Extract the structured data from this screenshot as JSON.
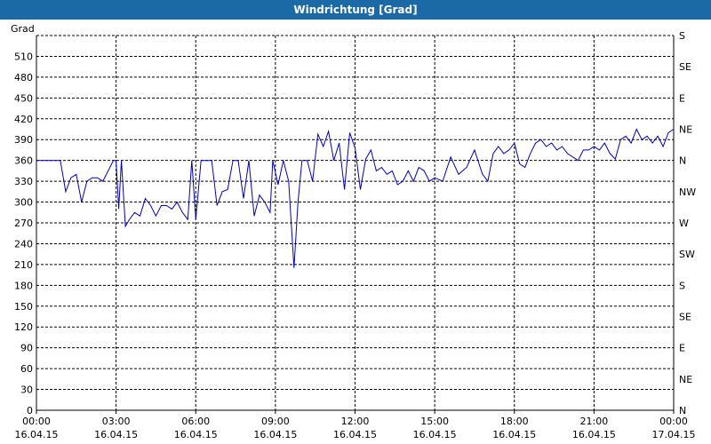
{
  "title": "Windrichtung [Grad]",
  "colors": {
    "titlebar": "#1b6aa5",
    "line": "#0000c0",
    "grid": "#000000"
  },
  "chart_data": {
    "type": "line",
    "title": "Windrichtung [Grad]",
    "ylabel": "Grad",
    "xlabel": "",
    "ylim": [
      0,
      540
    ],
    "xlim": [
      "16.04.15 00:00",
      "17.04.15 00:00"
    ],
    "grid": true,
    "y_ticks": [
      0,
      30,
      60,
      90,
      120,
      150,
      180,
      210,
      240,
      270,
      300,
      330,
      360,
      390,
      420,
      450,
      480,
      510
    ],
    "right_axis_labels": [
      "N",
      "NE",
      "E",
      "SE",
      "S",
      "SW",
      "W",
      "NW",
      "N",
      "NE",
      "E",
      "SE",
      "S"
    ],
    "x_tick_labels": [
      {
        "time": "00:00",
        "date": "16.04.15"
      },
      {
        "time": "03:00",
        "date": "16.04.15"
      },
      {
        "time": "06:00",
        "date": "16.04.15"
      },
      {
        "time": "09:00",
        "date": "16.04.15"
      },
      {
        "time": "12:00",
        "date": "16.04.15"
      },
      {
        "time": "15:00",
        "date": "16.04.15"
      },
      {
        "time": "18:00",
        "date": "16.04.15"
      },
      {
        "time": "21:00",
        "date": "16.04.15"
      },
      {
        "time": "00:00",
        "date": "17.04.15"
      }
    ],
    "series": [
      {
        "x_hours": [
          0,
          0.3,
          0.6,
          0.9,
          1.1,
          1.3,
          1.5,
          1.7,
          1.9,
          2.1,
          2.3,
          2.5,
          2.7,
          2.9,
          3.0,
          3.1,
          3.2,
          3.35,
          3.5,
          3.7,
          3.9,
          4.1,
          4.3,
          4.5,
          4.7,
          4.9,
          5.1,
          5.3,
          5.5,
          5.7,
          5.85,
          6.0,
          6.2,
          6.4,
          6.6,
          6.8,
          7.0,
          7.2,
          7.4,
          7.6,
          7.8,
          8.0,
          8.2,
          8.4,
          8.6,
          8.8,
          8.9,
          9.1,
          9.3,
          9.5,
          9.7,
          9.85,
          10.0,
          10.2,
          10.4,
          10.6,
          10.8,
          11.0,
          11.2,
          11.4,
          11.6,
          11.8,
          12.0,
          12.2,
          12.4,
          12.6,
          12.8,
          13.0,
          13.2,
          13.4,
          13.6,
          13.8,
          14.0,
          14.2,
          14.4,
          14.6,
          14.8,
          15.0,
          15.3,
          15.6,
          15.9,
          16.2,
          16.5,
          16.8,
          17.0,
          17.2,
          17.4,
          17.6,
          17.8,
          18.0,
          18.2,
          18.4,
          18.6,
          18.8,
          19.0,
          19.2,
          19.4,
          19.6,
          19.8,
          20.0,
          20.2,
          20.4,
          20.6,
          20.8,
          21.0,
          21.2,
          21.4,
          21.6,
          21.8,
          22.0,
          22.2,
          22.4,
          22.6,
          22.8,
          23.0,
          23.2,
          23.4,
          23.6,
          23.8,
          24.0
        ],
        "y": [
          360,
          360,
          360,
          360,
          315,
          335,
          340,
          300,
          330,
          335,
          335,
          330,
          345,
          360,
          360,
          290,
          360,
          265,
          275,
          285,
          280,
          305,
          295,
          280,
          295,
          295,
          290,
          300,
          285,
          275,
          360,
          275,
          360,
          360,
          360,
          295,
          315,
          318,
          360,
          360,
          305,
          360,
          280,
          310,
          300,
          285,
          360,
          325,
          360,
          330,
          205,
          300,
          360,
          360,
          330,
          398,
          380,
          402,
          360,
          385,
          318,
          400,
          378,
          318,
          362,
          375,
          345,
          350,
          340,
          345,
          325,
          330,
          345,
          330,
          350,
          345,
          330,
          335,
          330,
          365,
          340,
          350,
          375,
          340,
          330,
          370,
          380,
          370,
          375,
          385,
          355,
          350,
          370,
          385,
          390,
          380,
          385,
          375,
          380,
          370,
          365,
          360,
          375,
          375,
          380,
          375,
          385,
          370,
          362,
          390,
          395,
          385,
          405,
          390,
          395,
          385,
          395,
          380,
          400,
          405
        ]
      }
    ]
  }
}
